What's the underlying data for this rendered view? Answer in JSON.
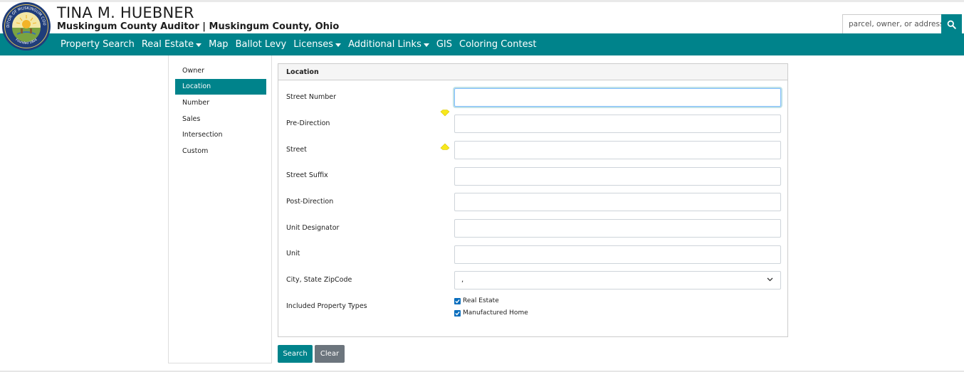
{
  "header": {
    "title": "TINA M. HUEBNER",
    "subtitle": "Muskingum County Auditor | Muskingum County, Ohio",
    "seal_top_text": "AUDITOR OF MUSKINGUM COUNTY",
    "seal_bottom_text": "Founded 1804",
    "search_placeholder": "parcel, owner, or address",
    "search_icon": "search-icon"
  },
  "nav": {
    "items": [
      {
        "label": "Property Search",
        "dropdown": false
      },
      {
        "label": "Real Estate",
        "dropdown": true
      },
      {
        "label": "Map",
        "dropdown": false
      },
      {
        "label": "Ballot Levy",
        "dropdown": false
      },
      {
        "label": "Licenses",
        "dropdown": true
      },
      {
        "label": "Additional Links",
        "dropdown": true
      },
      {
        "label": "GIS",
        "dropdown": false
      },
      {
        "label": "Coloring Contest",
        "dropdown": false
      }
    ]
  },
  "sidebar": {
    "items": [
      {
        "label": "Owner",
        "active": false
      },
      {
        "label": "Location",
        "active": true
      },
      {
        "label": "Number",
        "active": false
      },
      {
        "label": "Sales",
        "active": false
      },
      {
        "label": "Intersection",
        "active": false
      },
      {
        "label": "Custom",
        "active": false
      }
    ]
  },
  "form": {
    "heading": "Location",
    "street_number_label": "Street Number",
    "street_number_value": "",
    "pre_direction_label": "Pre-Direction",
    "pre_direction_value": "",
    "street_label": "Street",
    "street_value": "",
    "street_suffix_label": "Street Suffix",
    "street_suffix_value": "",
    "post_direction_label": "Post-Direction",
    "post_direction_value": "",
    "unit_designator_label": "Unit Designator",
    "unit_designator_value": "",
    "unit_label": "Unit",
    "unit_value": "",
    "city_label": "City, State ZipCode",
    "city_value": ",",
    "property_types_label": "Included Property Types",
    "type_real_estate": "Real Estate",
    "type_real_estate_checked": true,
    "type_manufactured_home": "Manufactured Home",
    "type_manufactured_home_checked": true
  },
  "buttons": {
    "search": "Search",
    "clear": "Clear"
  },
  "colors": {
    "brand_teal": "#00838b",
    "clear_gray": "#6c757d",
    "checkbox_blue": "#0a6ebd",
    "hint_yellow": "#f7e81c"
  }
}
